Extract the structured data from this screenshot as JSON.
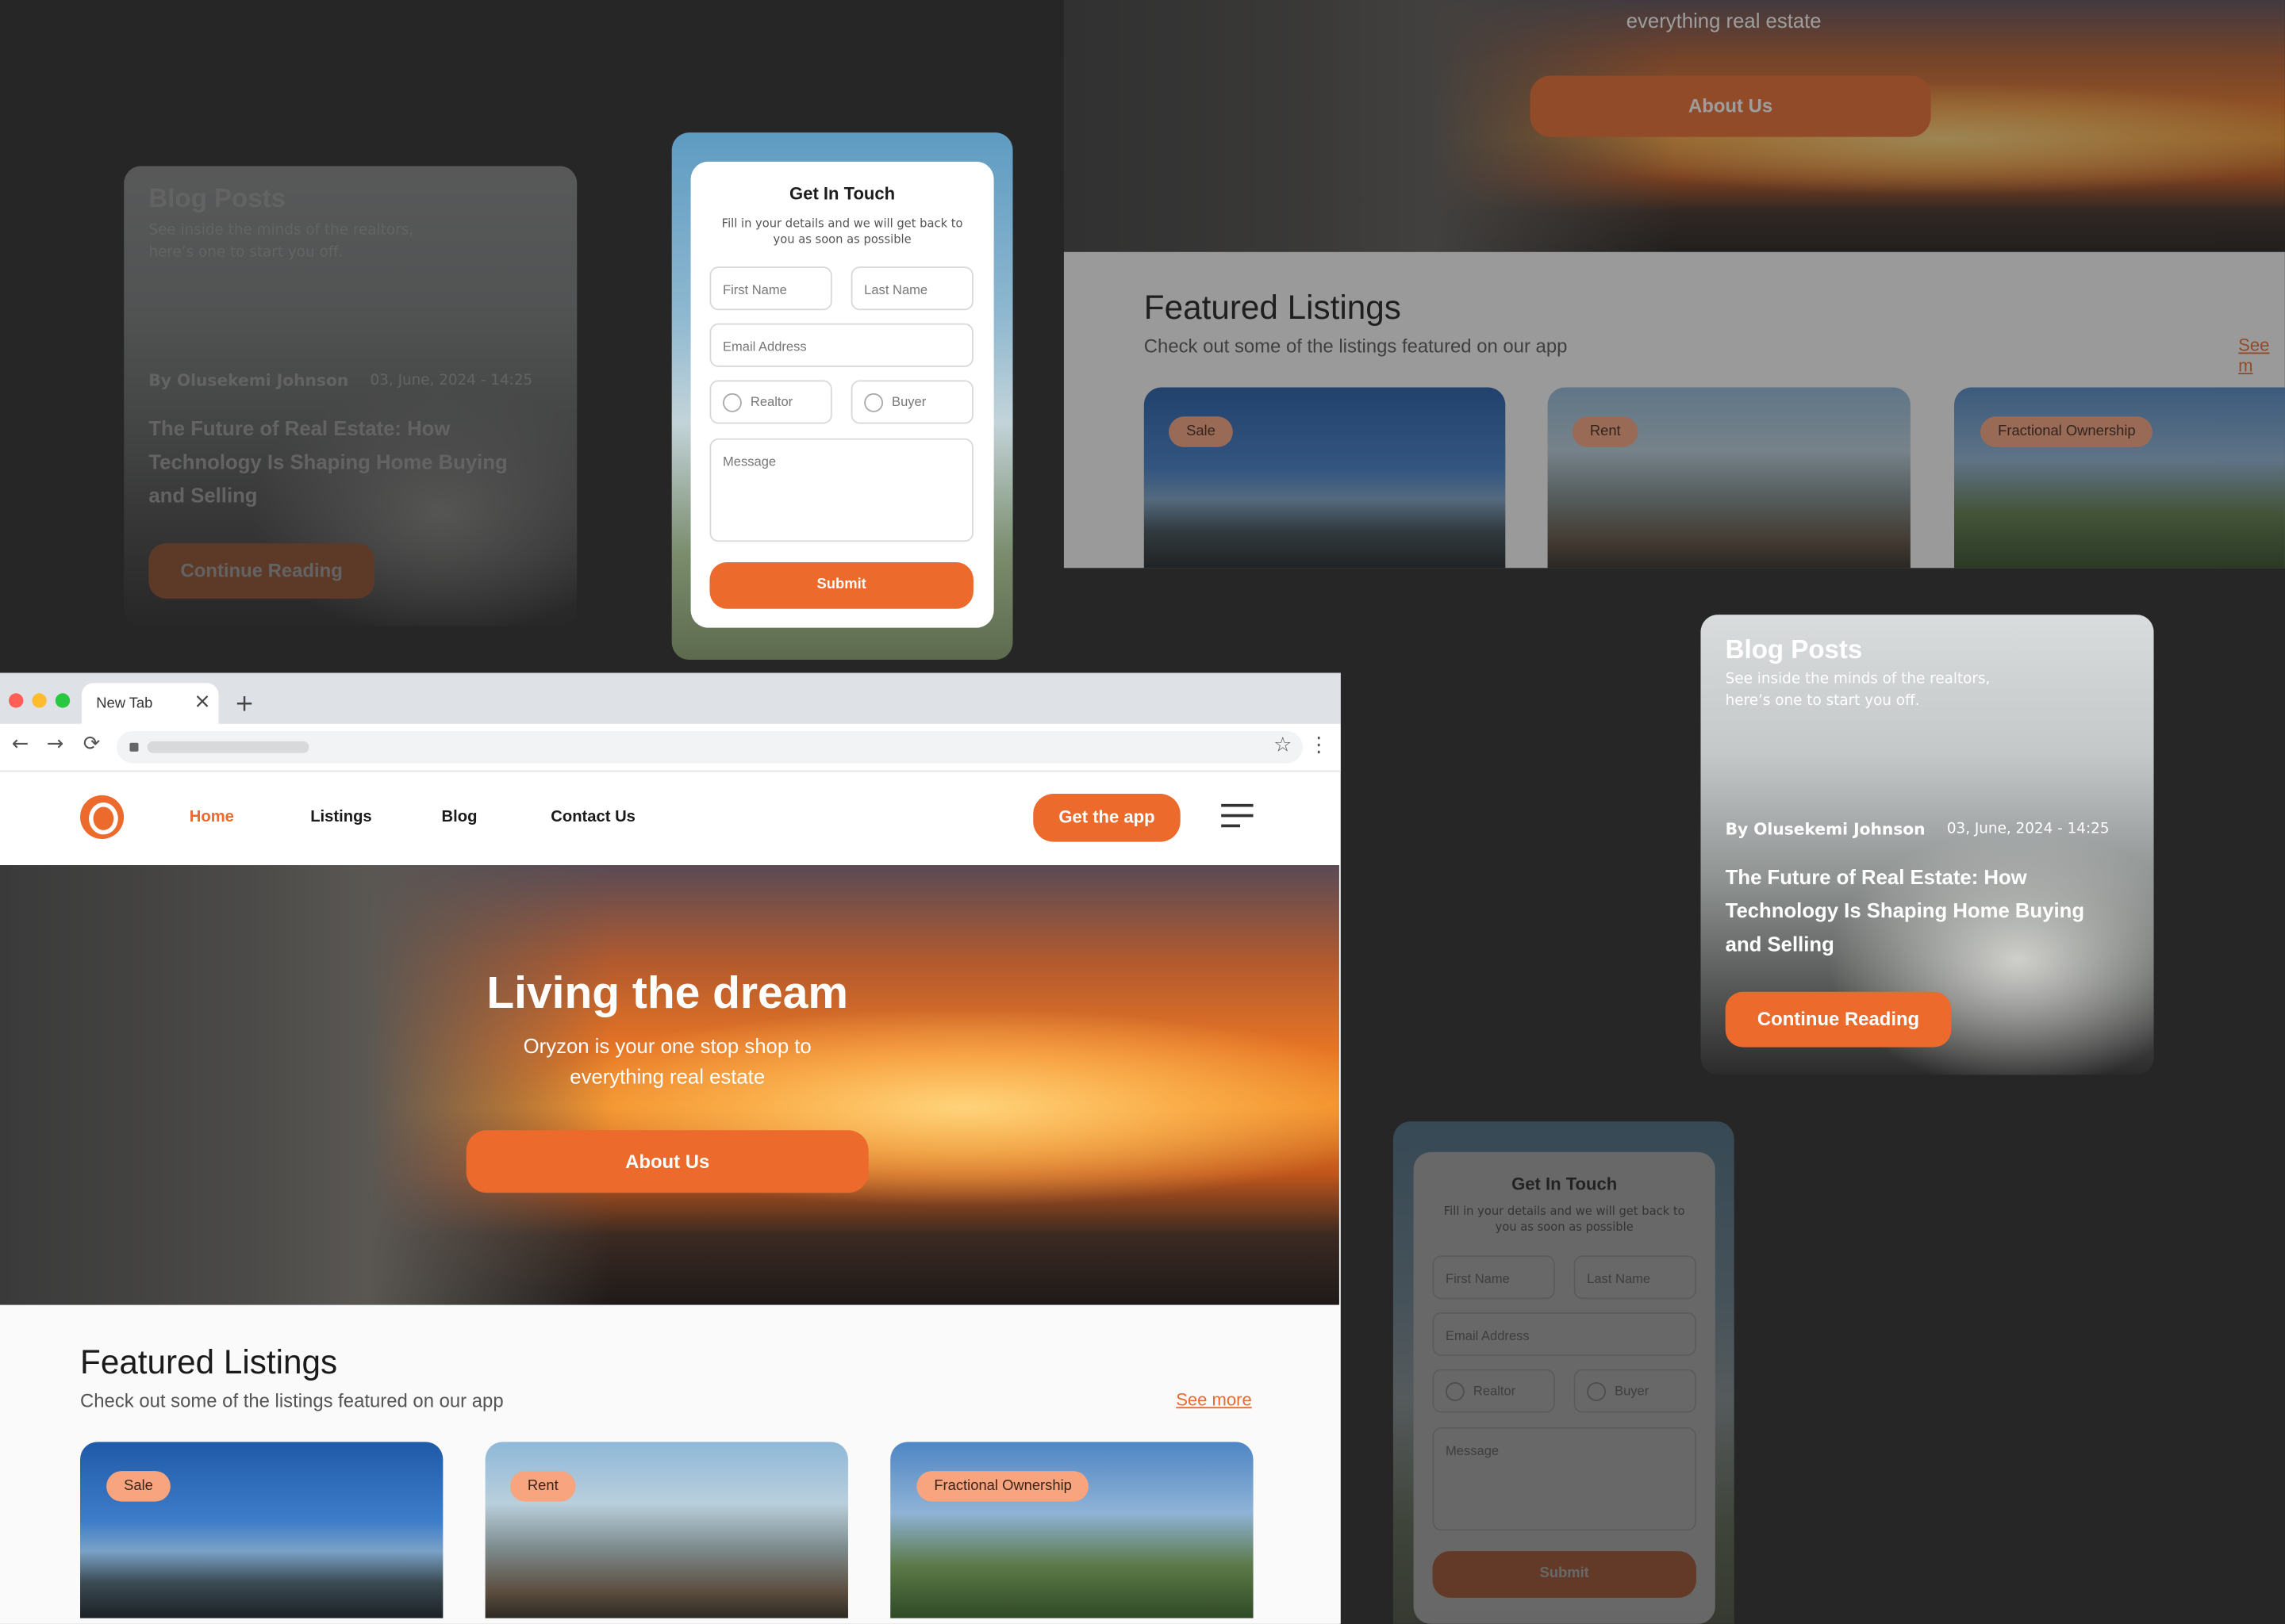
{
  "browser": {
    "tab_title": "New Tab",
    "tab_close": "×",
    "new_tab": "+",
    "back": "←",
    "forward": "→",
    "reload": "⟳",
    "star": "☆",
    "menu": "⋮"
  },
  "site": {
    "nav": {
      "home": "Home",
      "listings": "Listings",
      "blog": "Blog",
      "contact": "Contact Us",
      "cta": "Get the app"
    },
    "hero": {
      "title": "Living the dream",
      "subtitle_line1": "Oryzon is your one stop shop to",
      "subtitle_line2": "everything real estate",
      "button": "About Us"
    },
    "featured": {
      "title": "Featured Listings",
      "subtitle": "Check out some of the listings featured on our app",
      "see_more": "See more",
      "see_more_cut": "See m",
      "listings": [
        {
          "tag": "Sale"
        },
        {
          "tag": "Rent"
        },
        {
          "tag": "Fractional Ownership"
        }
      ]
    }
  },
  "blog": {
    "heading": "Blog Posts",
    "sub_line1": "See inside the minds of the realtors,",
    "sub_line2": "here’s one to start you off.",
    "author": "By Olusekemi Johnson",
    "date": "03, June, 2024 - 14:25",
    "title_line1": "The Future of Real Estate: How",
    "title_line2": "Technology Is Shaping Home Buying",
    "title_line3": "and Selling",
    "button": "Continue Reading"
  },
  "contact": {
    "title": "Get In Touch",
    "sub_line1": "Fill in your details and we will get back to",
    "sub_line2": "you as soon as possible",
    "first_name": "First Name",
    "last_name": "Last Name",
    "email": "Email Address",
    "realtor": "Realtor",
    "buyer": "Buyer",
    "message": "Message",
    "submit": "Submit"
  },
  "colors": {
    "accent": "#eb6a2c",
    "tag": "#f7a47f",
    "background": "#262626"
  }
}
